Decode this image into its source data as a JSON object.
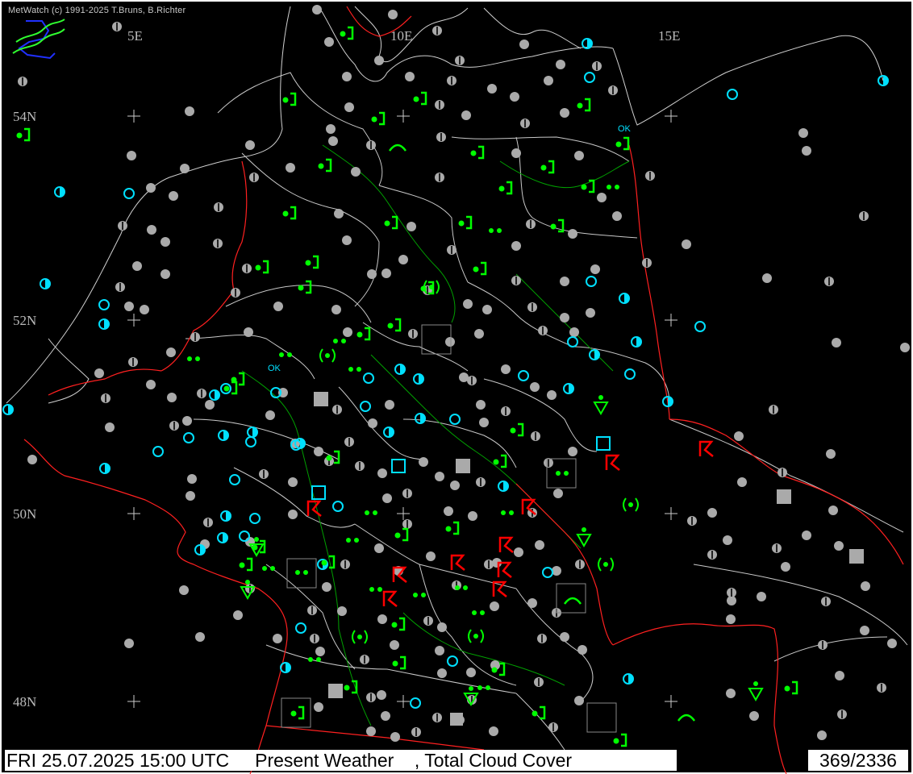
{
  "credit": "MetWatch  (c) 1991-2025 T.Bruns, B.Richter",
  "footer": {
    "datetime": "FRI 25.07.2025 15:00 UTC",
    "product": "Present Weather",
    "overlay": ", Total Cloud Cover",
    "station_count": "369/2336"
  },
  "longitude_labels": [
    "5E",
    "10E",
    "15E"
  ],
  "latitude_labels": [
    "54N",
    "52N",
    "50N",
    "48N"
  ],
  "colors": {
    "background": "#000000",
    "borders": "#ff2020",
    "regions": "#d0d0d0",
    "rivers": "#00a000",
    "rain_symbols": "#00ff00",
    "thunder_symbols": "#ff0000",
    "cloud_cover_gray": "#aaaaaa",
    "cloud_cover_cyan": "#00e0ff"
  },
  "logo_icon": "metwatch-logo-icon",
  "status_ok": "OK"
}
